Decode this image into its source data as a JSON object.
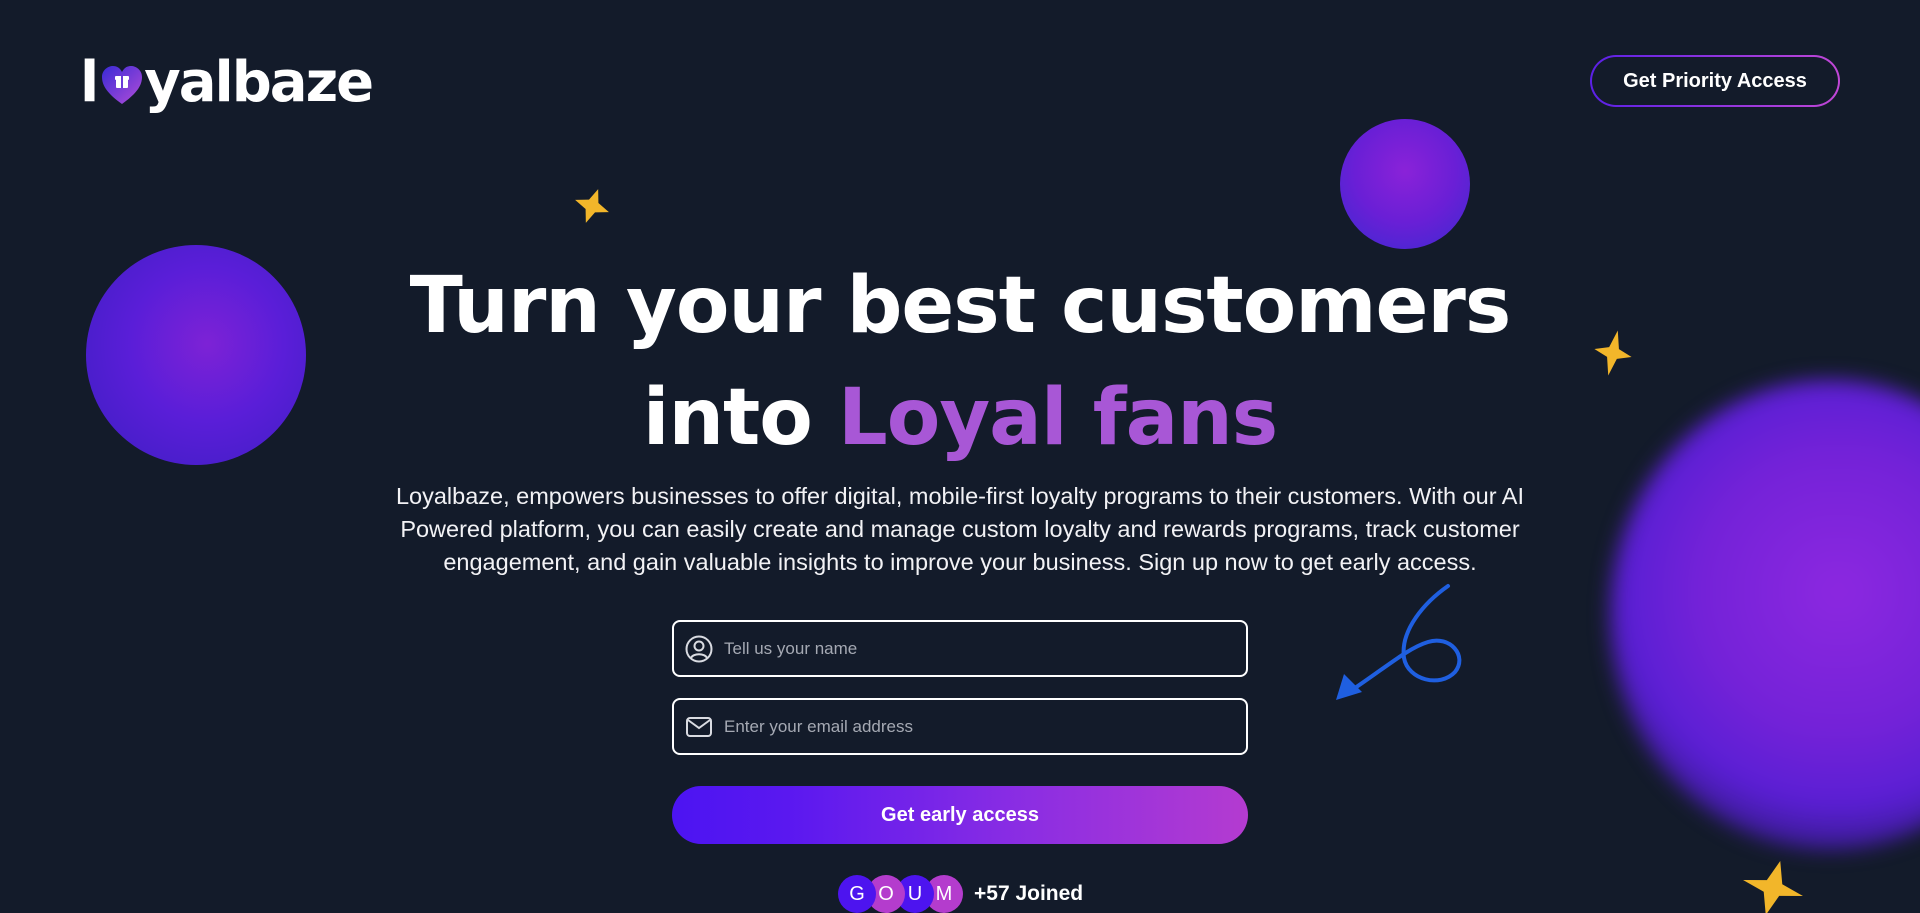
{
  "header": {
    "logo_prefix": "l",
    "logo_suffix": "yalbaze",
    "priority_button": "Get Priority Access"
  },
  "hero": {
    "title_line1": "Turn your best customers",
    "title_line2_plain": "into ",
    "title_line2_accent": "Loyal fans",
    "description": "Loyalbaze, empowers businesses to offer digital, mobile-first loyalty programs to their customers. With our AI Powered platform, you can easily create and manage custom loyalty and rewards programs, track customer engagement, and gain valuable insights to improve your business. Sign up now to get early access."
  },
  "form": {
    "name_placeholder": "Tell us your name",
    "name_value": "",
    "email_placeholder": "Enter your email address",
    "email_value": "",
    "submit_label": "Get early access"
  },
  "joined": {
    "avatars": [
      "G",
      "O",
      "U",
      "M"
    ],
    "text": "+57 Joined"
  },
  "icons": {
    "logo_heart": "heart-gift-icon",
    "name_field": "user-circle-icon",
    "email_field": "envelope-icon",
    "decor_stars": "four-point-star-icon",
    "decor_arrow": "curly-arrow-icon"
  },
  "colors": {
    "background": "#131b2a",
    "accent_text": "#a857d6",
    "cta_gradient_start": "#4c14f2",
    "cta_gradient_end": "#b43bd0",
    "star": "#f2b62a",
    "arrow": "#1f5fe0"
  }
}
